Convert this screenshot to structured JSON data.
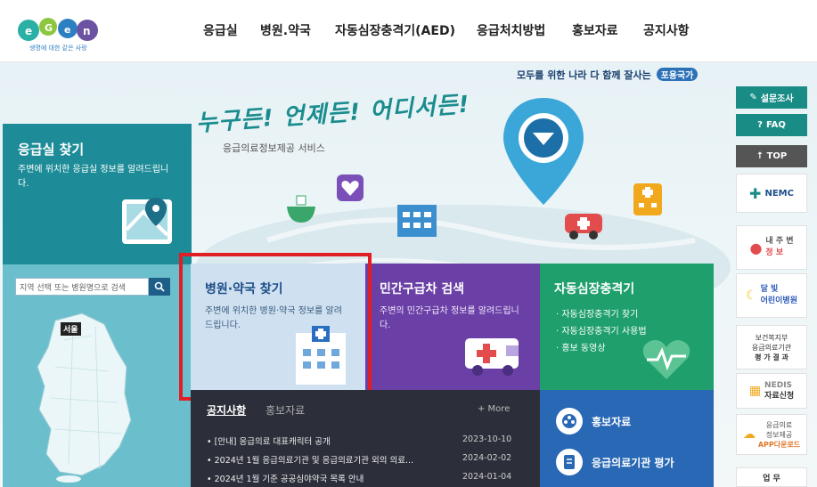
{
  "header": {
    "logo_text": "생명에 대한 같은 사랑",
    "nav": [
      "응급실",
      "병원.약국",
      "자동심장충격기(AED)",
      "응급처치방법",
      "홍보자료",
      "공지사항"
    ]
  },
  "hero": {
    "slogan": "모두를 위한 나라 다 함께 잘사는",
    "slogan_badge": "포용국가",
    "title": "누구든! 언제든! 어디서든!",
    "subtitle": "응급의료정보제공 서비스"
  },
  "er_panel": {
    "title": "응급실 찾기",
    "desc": "주변에 위치한 응급실 정보를 알려드립니다."
  },
  "region": {
    "search_placeholder": "지역 선택 또는 병원명으로 검색",
    "seoul": "서울"
  },
  "tiles": {
    "hospital": {
      "title": "병원·약국 찾기",
      "desc": "주변에 위치한 병원·약국 정보를 알려드립니다."
    },
    "ambulance": {
      "title": "민간구급차 검색",
      "desc": "주변의 민간구급차 정보를 알려드립니다."
    },
    "aed": {
      "title": "자동심장충격기",
      "items": [
        "· 자동심장충격기 찾기",
        "· 자동심장충격기 사용법",
        "· 홍보 동영상"
      ]
    }
  },
  "notice": {
    "tab_active": "공지사항",
    "tab_inactive": "홍보자료",
    "more": "+ More",
    "rows": [
      {
        "title": "• [안내] 응급의료 대표캐릭터 공개",
        "date": "2023-10-10"
      },
      {
        "title": "• 2024년 1월 응급의료기관 및 응급의료기관 외의 의료...",
        "date": "2024-02-02"
      },
      {
        "title": "• 2024년 1월 기준 공공심야약국 목록 안내",
        "date": "2024-01-04"
      }
    ]
  },
  "promo": {
    "item1": "홍보자료",
    "item2": "응급의료기관 평가"
  },
  "sidebar": {
    "survey": "설문조사",
    "faq": "FAQ",
    "top": "↑ TOP",
    "nemc": "NEMC",
    "nearby_line1": "내 주 변",
    "nearby_line2": "정   보",
    "moon_line1": "달   빛",
    "moon_line2": "어린이병원",
    "eval_line1": "보건복지부",
    "eval_line2": "응급의료기관",
    "eval_line3": "평 가 결 과",
    "nedis_line1": "NEDIS",
    "nedis_line2": "자료신청",
    "app_line1": "응급의료",
    "app_line2": "정보제공",
    "app_line3": "APP다운로드",
    "business": "업   무"
  },
  "colors": {
    "teal": "#1d8c98",
    "purple": "#6a3fa6",
    "green": "#1e9f6c",
    "blue": "#2868b5",
    "highlight": "#e01e24"
  }
}
